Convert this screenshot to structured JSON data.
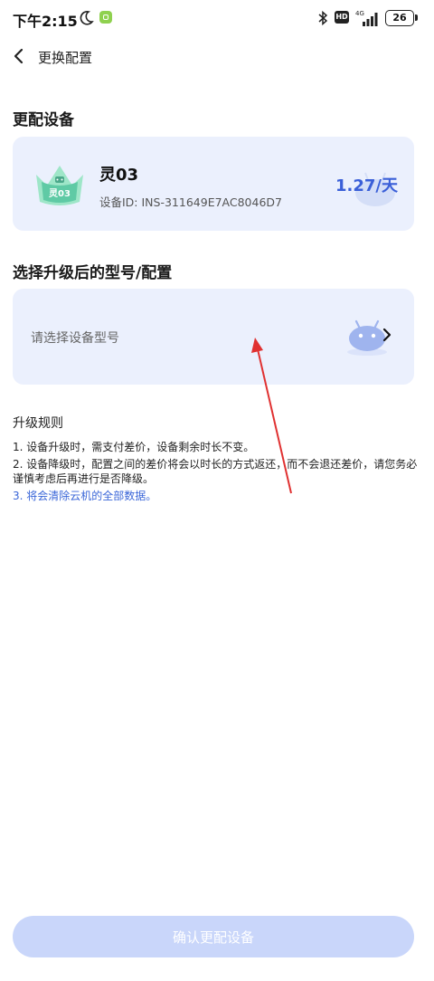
{
  "status_bar": {
    "time": "下午2:15",
    "hd_label": "HD",
    "network_label": "4G",
    "battery": "26"
  },
  "header": {
    "title": "更换配置"
  },
  "current_device": {
    "section_title": "更配设备",
    "badge_text": "灵03",
    "name": "灵03",
    "id_label": "设备ID: INS-311649E7AC8046D7",
    "price": "1.27/天"
  },
  "upgrade": {
    "section_title": "选择升级后的型号/配置",
    "placeholder": "请选择设备型号"
  },
  "rules": {
    "title": "升级规则",
    "items": [
      "1. 设备升级时，需支付差价，设备剩余时长不变。",
      "2. 设备降级时，配置之间的差价将会以时长的方式返还，而不会退还差价，请您务必谨慎考虑后再进行是否降级。",
      "3. 将会清除云机的全部数据。"
    ]
  },
  "footer": {
    "confirm_label": "确认更配设备"
  },
  "colors": {
    "accent": "#3a5fd8",
    "card_background": "#ebf0fd",
    "button_disabled": "#c9d6fa",
    "annotation_arrow": "#e03131"
  }
}
